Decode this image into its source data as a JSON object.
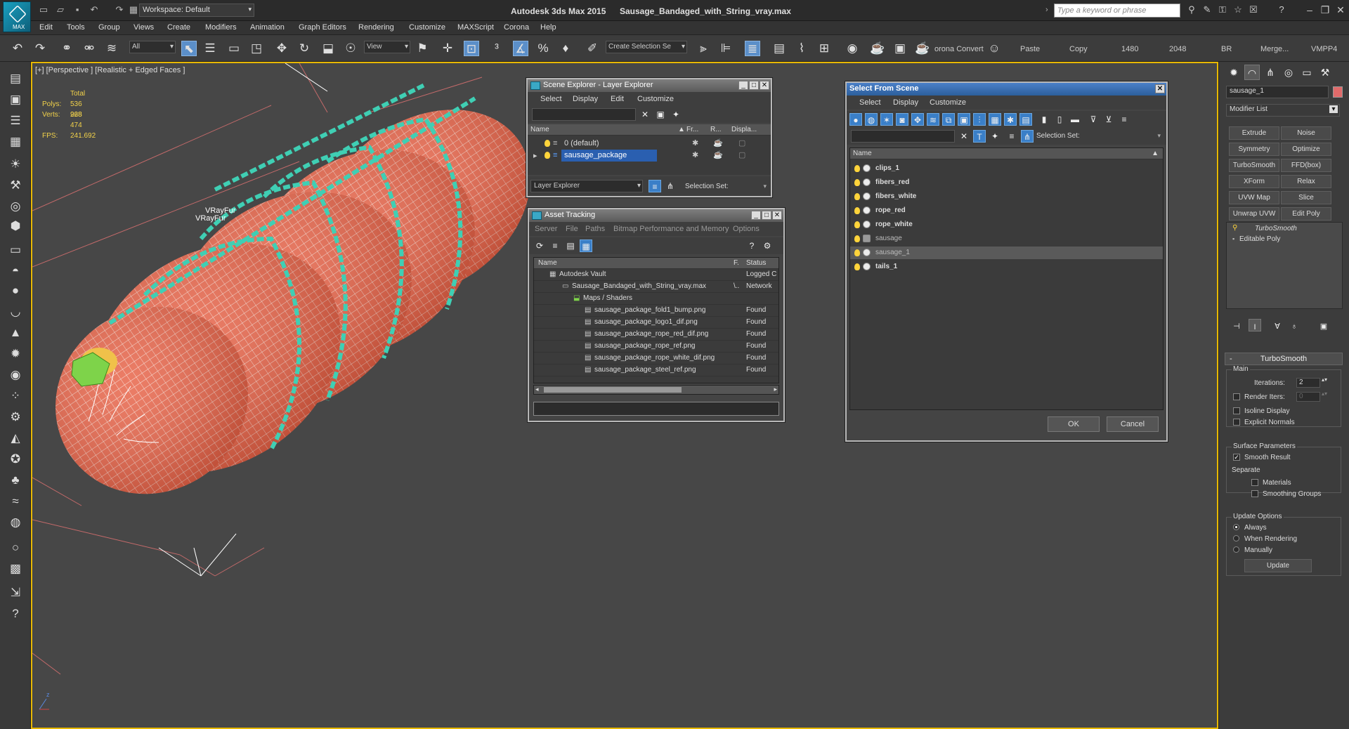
{
  "titlebar": {
    "workspace": "Workspace: Default",
    "app_name": "Autodesk 3ds Max  2015",
    "file_name": "Sausage_Bandaged_with_String_vray.max",
    "search_placeholder": "Type a keyword or phrase",
    "logo_text": "MAX"
  },
  "menu": [
    "Edit",
    "Tools",
    "Group",
    "Views",
    "Create",
    "Modifiers",
    "Animation",
    "Graph Editors",
    "Rendering",
    "Customize",
    "MAXScript",
    "Corona",
    "Help"
  ],
  "toolbar": {
    "filter": "All",
    "ref_coord": "View",
    "selection_set": "Create Selection Se",
    "corona_convert": "orona Convert",
    "paste": "Paste",
    "copy": "Copy",
    "res_w": "1480",
    "res_h": "2048",
    "br": "BR",
    "merge": "Merge...",
    "vmpp": "VMPP4"
  },
  "viewport": {
    "label": "[+] [Perspective ] [Realistic + Edged Faces ]",
    "stats_total": "Total",
    "polys_label": "Polys:",
    "polys_value": "536 928",
    "verts_label": "Verts:",
    "verts_value": "268 474",
    "fps_label": "FPS:",
    "fps_value": "241.692",
    "vrayfur_1": "VRayFur",
    "vrayfur_2": "VRayFur"
  },
  "scene_explorer": {
    "title": "Scene Explorer - Layer Explorer",
    "menu": [
      "Select",
      "Display",
      "Edit",
      "Customize"
    ],
    "col_name": "Name",
    "col_fr": "Fr...",
    "col_r": "R...",
    "col_display": "Displa...",
    "rows": [
      "0 (default)",
      "sausage_package"
    ],
    "footer_mode": "Layer Explorer",
    "footer_selset": "Selection Set:"
  },
  "asset_tracking": {
    "title": "Asset Tracking",
    "menu": [
      "Server",
      "File",
      "Paths",
      "Bitmap Performance and Memory",
      "Options"
    ],
    "col_name": "Name",
    "col_f": "F.",
    "col_status": "Status",
    "rows": [
      {
        "name": "Autodesk Vault",
        "f": "",
        "status": "Logged C"
      },
      {
        "name": "Sausage_Bandaged_with_String_vray.max",
        "f": "\\..",
        "status": "Network"
      },
      {
        "name": "Maps / Shaders",
        "f": "",
        "status": ""
      },
      {
        "name": "sausage_package_fold1_bump.png",
        "f": "",
        "status": "Found"
      },
      {
        "name": "sausage_package_logo1_dif.png",
        "f": "",
        "status": "Found"
      },
      {
        "name": "sausage_package_rope_red_dif.png",
        "f": "",
        "status": "Found"
      },
      {
        "name": "sausage_package_rope_ref.png",
        "f": "",
        "status": "Found"
      },
      {
        "name": "sausage_package_rope_white_dif.png",
        "f": "",
        "status": "Found"
      },
      {
        "name": "sausage_package_steel_ref.png",
        "f": "",
        "status": "Found"
      }
    ]
  },
  "select_from_scene": {
    "title": "Select From Scene",
    "menu": [
      "Select",
      "Display",
      "Customize"
    ],
    "selset": "Selection Set:",
    "col_name": "Name",
    "rows": [
      "clips_1",
      "fibers_red",
      "fibers_white",
      "rope_red",
      "rope_white",
      "sausage",
      "sausage_1",
      "tails_1"
    ],
    "ok": "OK",
    "cancel": "Cancel"
  },
  "command_panel": {
    "object_name": "sausage_1",
    "modifier_list": "Modifier List",
    "buttons": [
      "Extrude",
      "Noise",
      "Symmetry",
      "Optimize",
      "TurboSmooth",
      "FFD(box)",
      "XForm",
      "Relax",
      "UVW Map",
      "Slice",
      "Unwrap UVW",
      "Edit Poly"
    ],
    "stack": [
      "TurboSmooth",
      "Editable Poly"
    ],
    "rollout_title": "TurboSmooth",
    "main_label": "Main",
    "iterations_label": "Iterations:",
    "iterations_value": "2",
    "render_iters_label": "Render Iters:",
    "render_iters_value": "0",
    "isoline": "Isoline Display",
    "explicit": "Explicit Normals",
    "surface_params": "Surface Parameters",
    "smooth_result": "Smooth Result",
    "separate": "Separate",
    "materials": "Materials",
    "smoothing_groups": "Smoothing Groups",
    "update_options": "Update Options",
    "always": "Always",
    "when_rendering": "When Rendering",
    "manually": "Manually",
    "update_btn": "Update"
  },
  "colors": {
    "sausage": "#e8654a",
    "rope": "#3fcfb4",
    "clip": "#7ed34a",
    "viewport_border": "#e8b800",
    "selection_blue": "#2a5fb0"
  }
}
